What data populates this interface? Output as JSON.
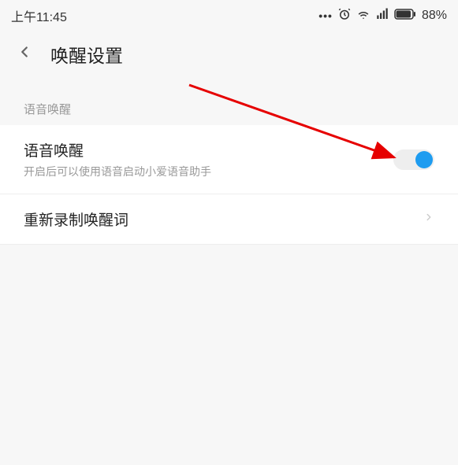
{
  "status_bar": {
    "time": "上午11:45",
    "battery": "88%"
  },
  "header": {
    "title": "唤醒设置"
  },
  "section": {
    "label": "语音唤醒"
  },
  "items": {
    "voice_wakeup": {
      "title": "语音唤醒",
      "desc": "开启后可以使用语音启动小爱语音助手"
    },
    "rerecord": {
      "title": "重新录制唤醒词"
    }
  },
  "icons": {
    "dots": "...",
    "alarm": "alarm",
    "wifi": "wifi",
    "signal": "signal",
    "battery": "battery"
  }
}
